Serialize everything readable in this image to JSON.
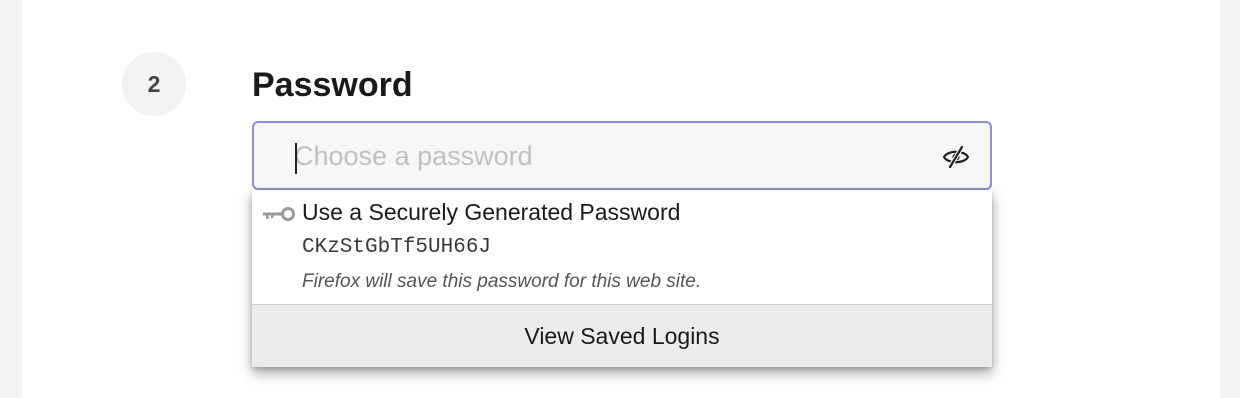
{
  "step": {
    "number": "2"
  },
  "password_field": {
    "title": "Password",
    "placeholder": "Choose a password",
    "value": "",
    "toggle_icon": "eye-slash-icon",
    "focus_border_color": "#8f8fd6"
  },
  "autocomplete": {
    "generated_item": {
      "icon": "key-icon",
      "title": "Use a Securely Generated Password",
      "password": "CKzStGbTf5UH66J",
      "note": "Firefox will save this password for this web site."
    },
    "footer_label": "View Saved Logins"
  }
}
